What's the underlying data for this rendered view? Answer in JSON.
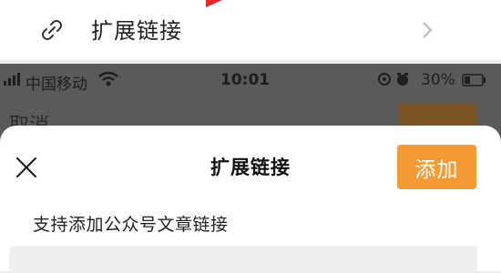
{
  "top_row": {
    "label": "扩展链接"
  },
  "status_bar": {
    "carrier": "中国移动",
    "time": "10:01",
    "battery": "30%"
  },
  "background_nav": {
    "cancel_label": "取消"
  },
  "sheet": {
    "title": "扩展链接",
    "add_label": "添加",
    "hint": "支持添加公众号文章链接"
  },
  "colors": {
    "accent": "#f39a34",
    "overlay": "#5a5a5a"
  }
}
